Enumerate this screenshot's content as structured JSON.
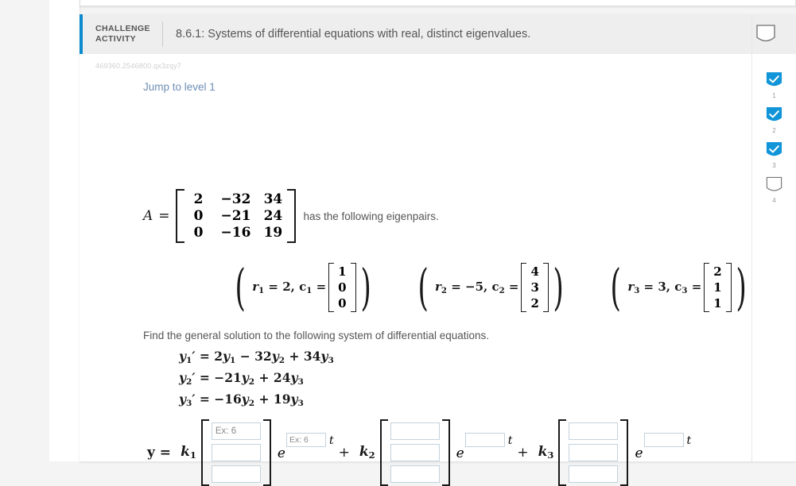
{
  "header": {
    "challenge_line1": "CHALLENGE",
    "challenge_line2": "ACTIVITY",
    "title": "8.6.1: Systems of differential equations with real, distinct eigenvalues.",
    "accent_color": "#0c8ace",
    "trophy_icon": "shield-outline-icon"
  },
  "activity_id": "469360.2546800.qx3zqy7",
  "jump_link": "Jump to level 1",
  "problem": {
    "matrix_label": "A",
    "equals": "=",
    "matrix": [
      [
        "2",
        "−32",
        "34"
      ],
      [
        "0",
        "−21",
        "24"
      ],
      [
        "0",
        "−16",
        "19"
      ]
    ],
    "after_matrix_text": "has the following eigenpairs.",
    "eigenpairs": [
      {
        "label": "r₁ = 2, c₁ =",
        "r_sym": "r",
        "r_sub": "1",
        "r_value": "2",
        "c_sym": "c",
        "c_sub": "1",
        "vector": [
          "1",
          "0",
          "0"
        ]
      },
      {
        "label": "r₂ = −5, c₂ =",
        "r_sym": "r",
        "r_sub": "2",
        "r_value": "−5",
        "c_sym": "c",
        "c_sub": "2",
        "vector": [
          "4",
          "3",
          "2"
        ]
      },
      {
        "label": "r₃ = 3, c₃ =",
        "r_sym": "r",
        "r_sub": "3",
        "r_value": "3",
        "c_sym": "c",
        "c_sub": "3",
        "vector": [
          "2",
          "1",
          "1"
        ]
      }
    ],
    "instruction": "Find the general solution to the following system of differential equations.",
    "system": [
      "y₁′ = 2y₁ − 32y₂ + 34y₃",
      "y₂′ = −21y₂ + 24y₃",
      "y₃′ = −16y₂ + 19y₃"
    ]
  },
  "answer": {
    "y_label": "y =",
    "terms": [
      {
        "coefficient": "k₁",
        "coef_sym": "k",
        "coef_sub": "1",
        "vector_values": [
          "",
          "",
          ""
        ],
        "vector_placeholders": [
          "Ex: 6",
          "",
          ""
        ],
        "exponent_value": "",
        "exponent_placeholder": "Ex: 6",
        "e_letter": "e",
        "t_letter": "t"
      },
      {
        "coefficient": "k₂",
        "coef_sym": "k",
        "coef_sub": "2",
        "vector_values": [
          "",
          "",
          ""
        ],
        "vector_placeholders": [
          "",
          "",
          ""
        ],
        "exponent_value": "",
        "exponent_placeholder": "",
        "e_letter": "e",
        "t_letter": "t"
      },
      {
        "coefficient": "k₃",
        "coef_sym": "k",
        "coef_sub": "3",
        "vector_values": [
          "",
          "",
          ""
        ],
        "vector_placeholders": [
          "",
          "",
          ""
        ],
        "exponent_value": "",
        "exponent_placeholder": "",
        "e_letter": "e",
        "t_letter": "t"
      }
    ],
    "plus": "+"
  },
  "progress": {
    "steps": [
      {
        "number": "1",
        "state": "complete",
        "icon": "check-badge-icon"
      },
      {
        "number": "2",
        "state": "complete",
        "icon": "check-badge-icon"
      },
      {
        "number": "3",
        "state": "complete",
        "icon": "check-badge-icon"
      },
      {
        "number": "4",
        "state": "incomplete",
        "icon": "empty-badge-icon"
      }
    ],
    "complete_color": "#1295d8",
    "incomplete_color": "#767676"
  }
}
